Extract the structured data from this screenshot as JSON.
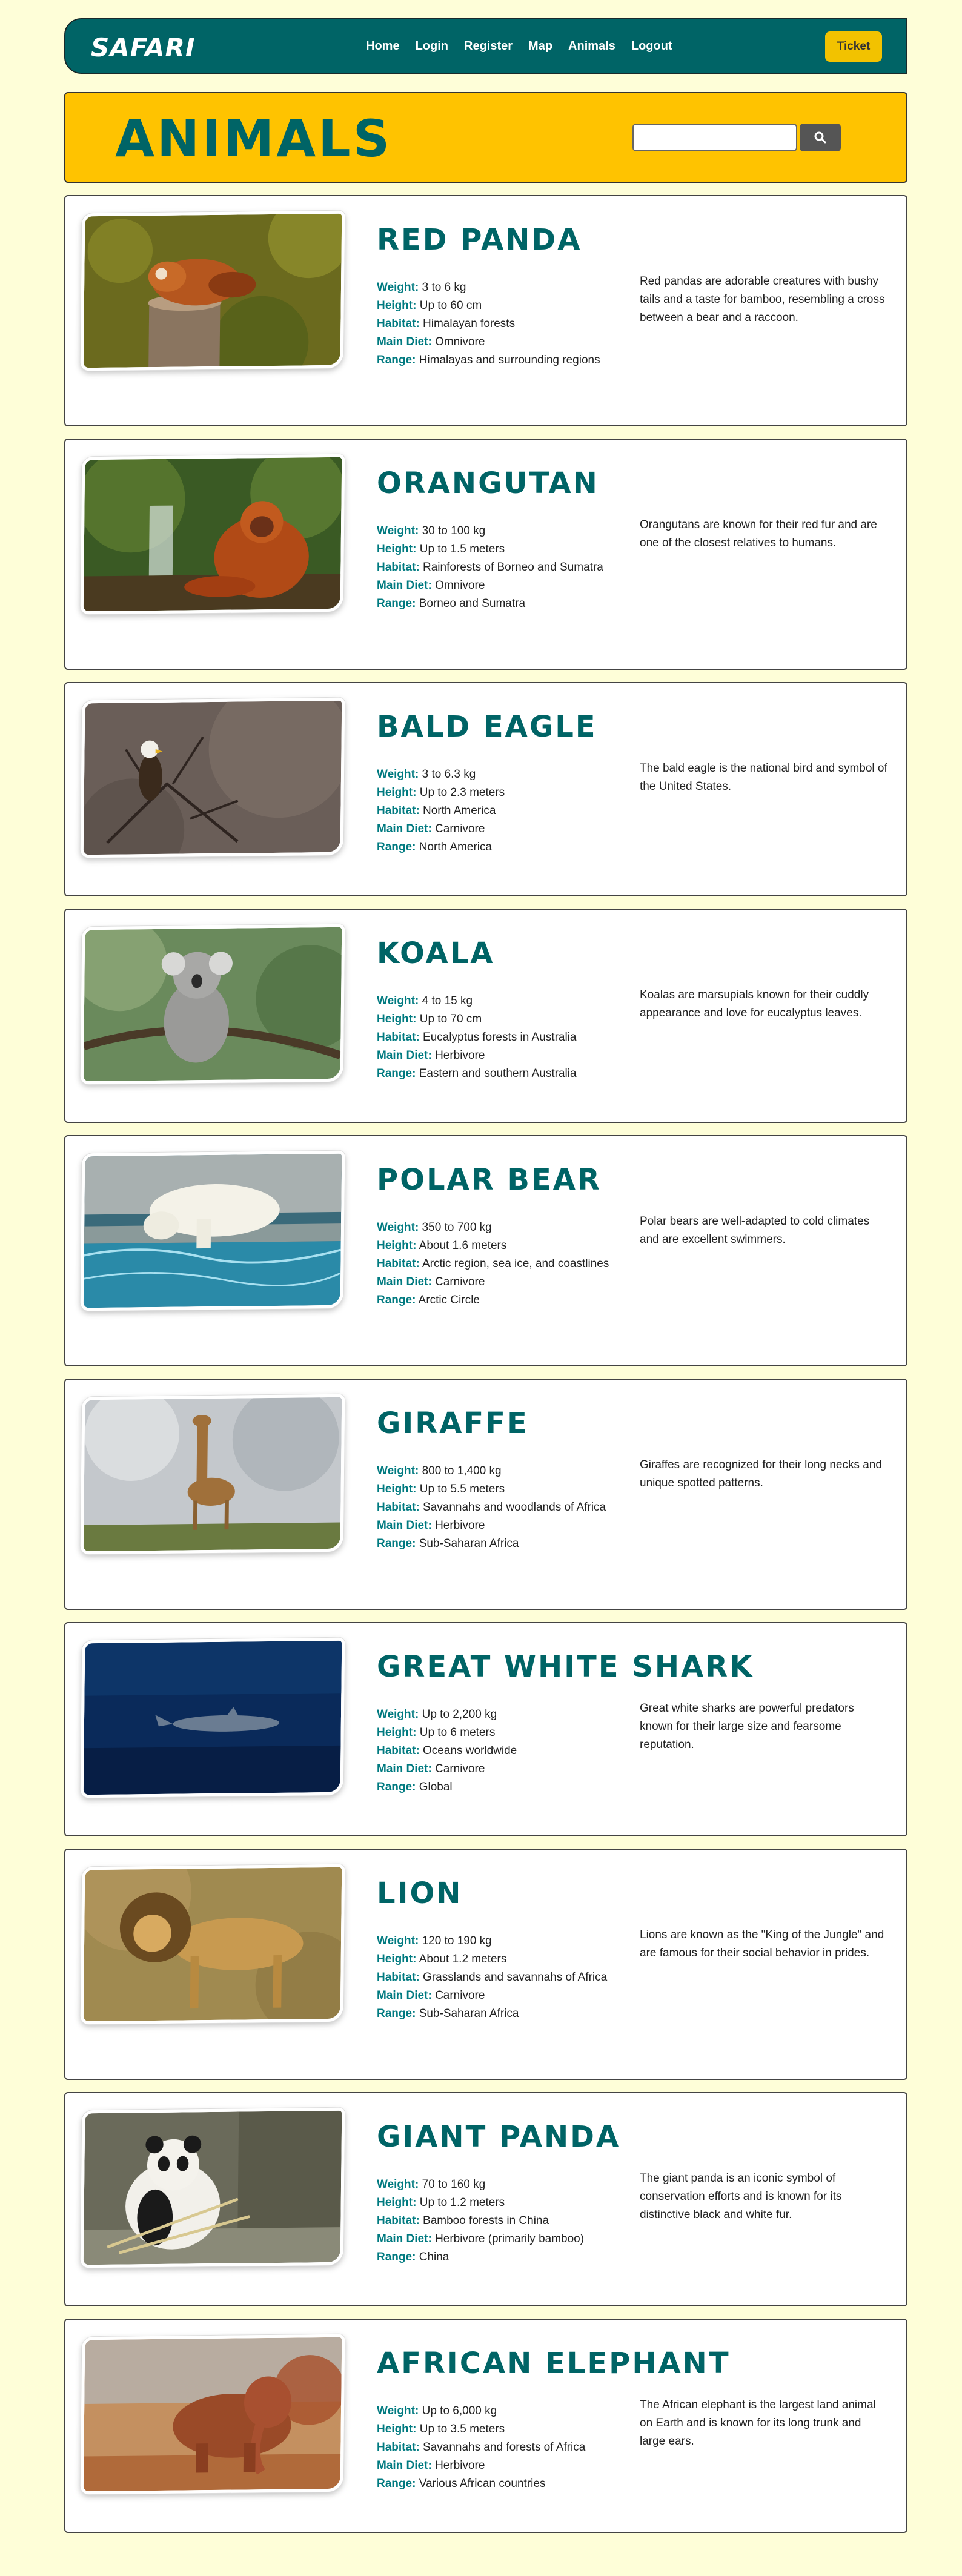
{
  "navbar": {
    "brand": "SAFARI",
    "links": [
      "Home",
      "Login",
      "Register",
      "Map",
      "Animals",
      "Logout"
    ],
    "ticket_label": "Ticket"
  },
  "hero": {
    "title": "ANIMALS",
    "search": {
      "value": "",
      "placeholder": ""
    }
  },
  "colors": {
    "accent": "#006466",
    "hero_bg": "#ffc300",
    "page_bg": "#fefed8",
    "ticket": "#f2c200"
  },
  "animals": [
    {
      "name": "RED PANDA",
      "image": "red-panda-photo",
      "weight": "3 to 6 kg",
      "height": "Up to 60 cm",
      "habitat": "Himalayan forests",
      "diet": "Omnivore",
      "range": "Himalayas and surrounding regions",
      "description": "Red pandas are adorable creatures with bushy tails and a taste for bamboo, resembling a cross between a bear and a raccoon."
    },
    {
      "name": "ORANGUTAN",
      "image": "orangutan-photo",
      "weight": "30 to 100 kg",
      "height": "Up to 1.5 meters",
      "habitat": "Rainforests of Borneo and Sumatra",
      "diet": "Omnivore",
      "range": "Borneo and Sumatra",
      "description": "Orangutans are known for their red fur and are one of the closest relatives to humans."
    },
    {
      "name": "BALD EAGLE",
      "image": "bald-eagle-photo",
      "weight": "3 to 6.3 kg",
      "height": "Up to 2.3 meters",
      "habitat": "North America",
      "diet": "Carnivore",
      "range": "North America",
      "description": "The bald eagle is the national bird and symbol of the United States."
    },
    {
      "name": "KOALA",
      "image": "koala-photo",
      "weight": "4 to 15 kg",
      "height": "Up to 70 cm",
      "habitat": "Eucalyptus forests in Australia",
      "diet": "Herbivore",
      "range": "Eastern and southern Australia",
      "description": "Koalas are marsupials known for their cuddly appearance and love for eucalyptus leaves."
    },
    {
      "name": "POLAR BEAR",
      "image": "polar-bear-photo",
      "weight": "350 to 700 kg",
      "height": "About 1.6 meters",
      "habitat": "Arctic region, sea ice, and coastlines",
      "diet": "Carnivore",
      "range": "Arctic Circle",
      "description": "Polar bears are well-adapted to cold climates and are excellent swimmers."
    },
    {
      "name": "GIRAFFE",
      "image": "giraffe-photo",
      "weight": "800 to 1,400 kg",
      "height": "Up to 5.5 meters",
      "habitat": "Savannahs and woodlands of Africa",
      "diet": "Herbivore",
      "range": "Sub-Saharan Africa",
      "description": "Giraffes are recognized for their long necks and unique spotted patterns."
    },
    {
      "name": "GREAT WHITE SHARK",
      "image": "great-white-shark-photo",
      "weight": "Up to 2,200 kg",
      "height": "Up to 6 meters",
      "habitat": "Oceans worldwide",
      "diet": "Carnivore",
      "range": "Global",
      "description": "Great white sharks are powerful predators known for their large size and fearsome reputation."
    },
    {
      "name": "LION",
      "image": "lion-photo",
      "weight": "120 to 190 kg",
      "height": "About 1.2 meters",
      "habitat": "Grasslands and savannahs of Africa",
      "diet": "Carnivore",
      "range": "Sub-Saharan Africa",
      "description": "Lions are known as the \"King of the Jungle\" and are famous for their social behavior in prides."
    },
    {
      "name": "GIANT PANDA",
      "image": "giant-panda-photo",
      "weight": "70 to 160 kg",
      "height": "Up to 1.2 meters",
      "habitat": "Bamboo forests in China",
      "diet": "Herbivore (primarily bamboo)",
      "range": "China",
      "description": "The giant panda is an iconic symbol of conservation efforts and is known for its distinctive black and white fur."
    },
    {
      "name": "AFRICAN ELEPHANT",
      "image": "african-elephant-photo",
      "weight": "Up to 6,000 kg",
      "height": "Up to 3.5 meters",
      "habitat": "Savannahs and forests of Africa",
      "diet": "Herbivore",
      "range": "Various African countries",
      "description": "The African elephant is the largest land animal on Earth and is known for its long trunk and large ears."
    }
  ],
  "labels": {
    "weight": "Weight:",
    "height": "Height:",
    "habitat": "Habitat:",
    "diet": "Main Diet:",
    "range": "Range:"
  }
}
